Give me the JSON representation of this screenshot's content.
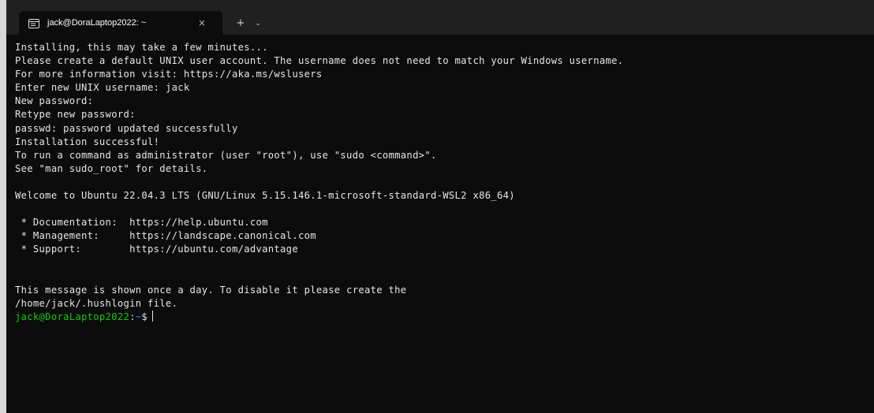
{
  "tab": {
    "title": "jack@DoraLaptop2022: ~",
    "close_glyph": "×",
    "new_tab_glyph": "+",
    "dropdown_glyph": "⌄",
    "icon": "terminal-tab-icon"
  },
  "terminal": {
    "lines": [
      "Installing, this may take a few minutes...",
      "Please create a default UNIX user account. The username does not need to match your Windows username.",
      "For more information visit: https://aka.ms/wslusers",
      "Enter new UNIX username: jack",
      "New password:",
      "Retype new password:",
      "passwd: password updated successfully",
      "Installation successful!",
      "To run a command as administrator (user \"root\"), use \"sudo <command>\".",
      "See \"man sudo_root\" for details.",
      "",
      "Welcome to Ubuntu 22.04.3 LTS (GNU/Linux 5.15.146.1-microsoft-standard-WSL2 x86_64)",
      "",
      " * Documentation:  https://help.ubuntu.com",
      " * Management:     https://landscape.canonical.com",
      " * Support:        https://ubuntu.com/advantage",
      "",
      "",
      "This message is shown once a day. To disable it please create the",
      "/home/jack/.hushlogin file."
    ],
    "prompt": {
      "user_host": "jack@DoraLaptop2022",
      "separator": ":",
      "path": "~",
      "symbol": "$"
    }
  },
  "colors": {
    "background": "#0c0c0c",
    "text": "#e6e6e6",
    "prompt_user": "#16c60c",
    "prompt_path": "#3b78ff",
    "tabbar": "#202020"
  }
}
